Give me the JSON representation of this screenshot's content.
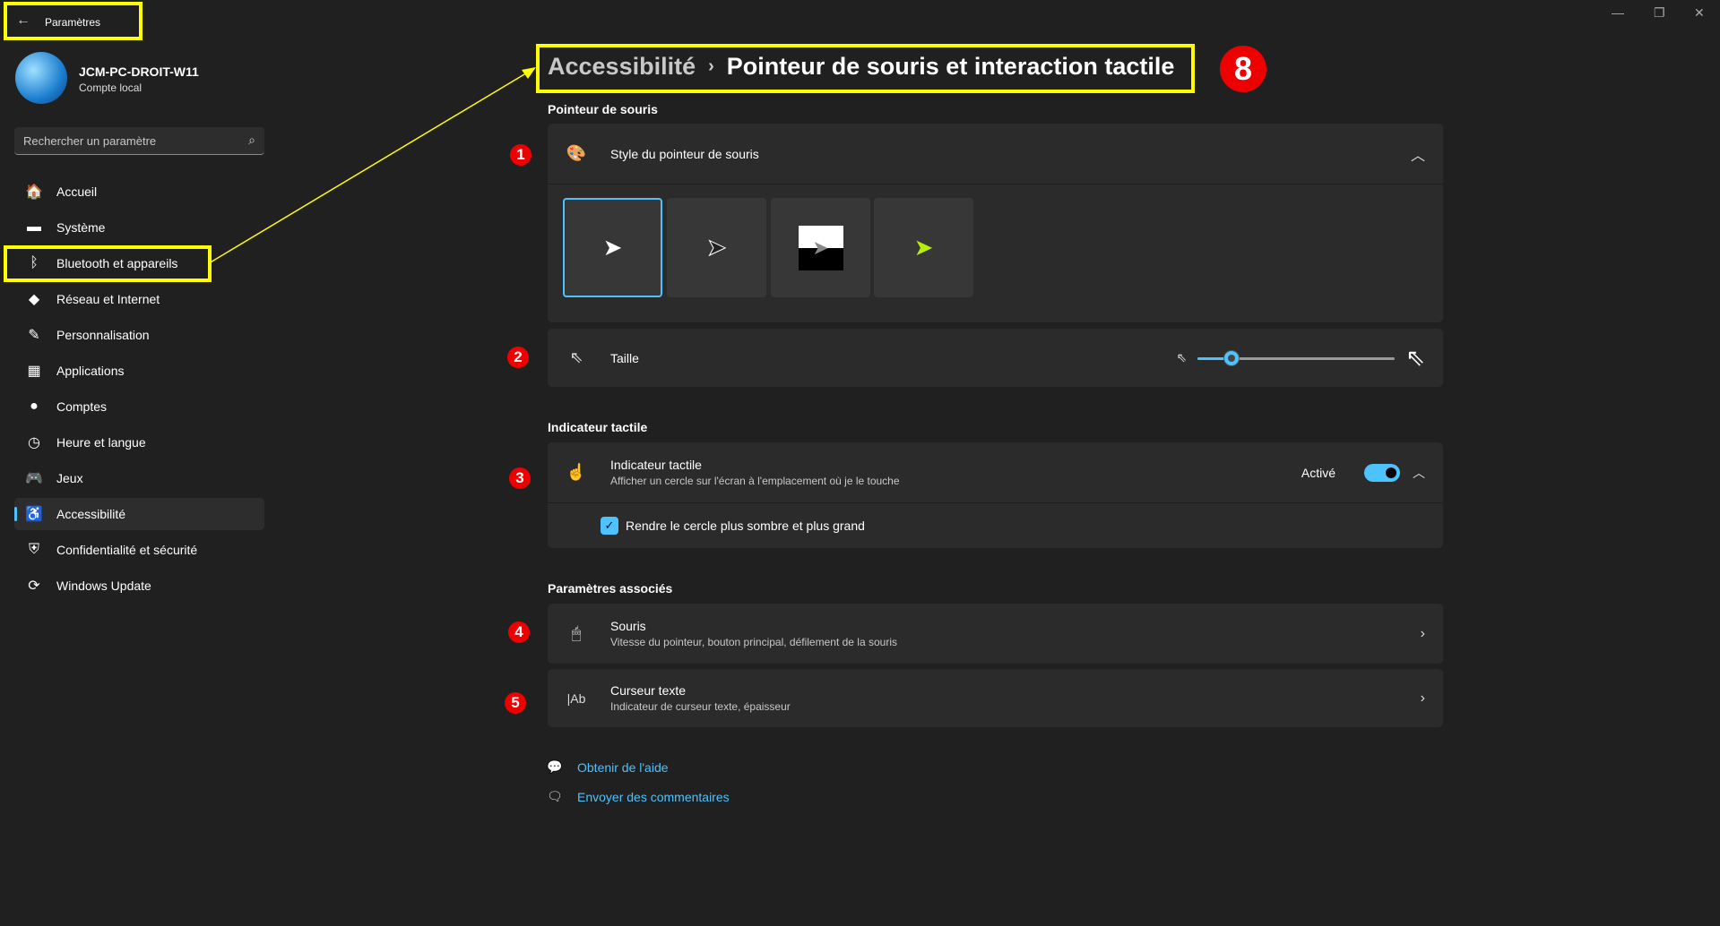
{
  "window": {
    "title": "Paramètres",
    "minimize": "—",
    "maximize": "❐",
    "close": "✕"
  },
  "user": {
    "name": "JCM-PC-DROIT-W11",
    "account": "Compte local"
  },
  "search": {
    "placeholder": "Rechercher un paramètre"
  },
  "nav": [
    {
      "label": "Accueil",
      "icon": "🏠"
    },
    {
      "label": "Système",
      "icon": "▬"
    },
    {
      "label": "Bluetooth et appareils",
      "icon": "ᛒ"
    },
    {
      "label": "Réseau et Internet",
      "icon": "◆"
    },
    {
      "label": "Personnalisation",
      "icon": "✎"
    },
    {
      "label": "Applications",
      "icon": "▦"
    },
    {
      "label": "Comptes",
      "icon": "●"
    },
    {
      "label": "Heure et langue",
      "icon": "◷"
    },
    {
      "label": "Jeux",
      "icon": "🎮"
    },
    {
      "label": "Accessibilité",
      "icon": "♿"
    },
    {
      "label": "Confidentialité et sécurité",
      "icon": "⛨"
    },
    {
      "label": "Windows Update",
      "icon": "⟳"
    }
  ],
  "breadcrumb": {
    "parent": "Accessibilité",
    "sep": "›",
    "current": "Pointeur de souris et interaction tactile"
  },
  "annotations": {
    "b1": "1",
    "b2": "2",
    "b3": "3",
    "b4": "4",
    "b5": "5",
    "b8": "8"
  },
  "pointer": {
    "section": "Pointeur de souris",
    "style_label": "Style du pointeur de souris",
    "size_label": "Taille",
    "size_value": 0.17
  },
  "touch": {
    "section": "Indicateur tactile",
    "title": "Indicateur tactile",
    "desc": "Afficher un cercle sur l'écran à l'emplacement où je le touche",
    "state": "Activé",
    "checkbox": "Rendre le cercle plus sombre et plus grand"
  },
  "related": {
    "section": "Paramètres associés",
    "mouse": {
      "title": "Souris",
      "desc": "Vitesse du pointeur, bouton principal, défilement de la souris"
    },
    "cursor": {
      "title": "Curseur texte",
      "desc": "Indicateur de curseur texte, épaisseur"
    }
  },
  "links": {
    "help": "Obtenir de l'aide",
    "feedback": "Envoyer des commentaires"
  },
  "colors": {
    "accent": "#4cc2ff",
    "highlight": "#ffff00",
    "badge": "#e00000"
  }
}
